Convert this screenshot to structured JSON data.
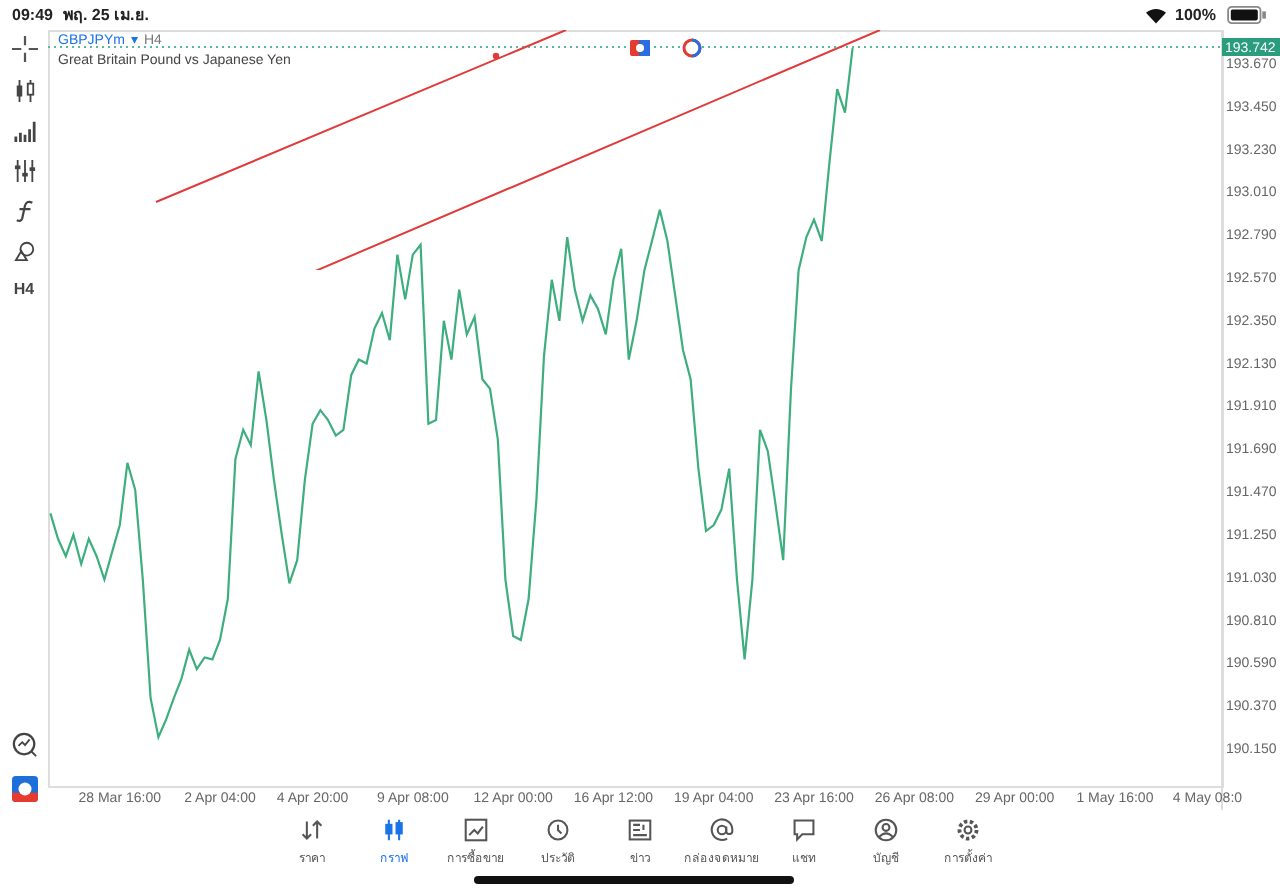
{
  "status_bar": {
    "time": "09:49",
    "date": "พฤ. 25 เม.ย.",
    "battery": "100%"
  },
  "toolbar": {
    "timeframe": "H4"
  },
  "chart_header": {
    "symbol": "GBPJPYm",
    "dropdown": "▾",
    "timeframe": "H4",
    "description": "Great Britain Pound vs Japanese Yen"
  },
  "current_price": "193.742",
  "chart_data": {
    "type": "line",
    "ylim": [
      189.826,
      193.834
    ],
    "categories": [
      null,
      null,
      null,
      null,
      null,
      null,
      null,
      null,
      null,
      "28 Mar 16:00",
      null,
      null,
      null,
      null,
      null,
      null,
      null,
      null,
      null,
      null,
      null,
      null,
      "2 Apr 04:00",
      null,
      null,
      null,
      null,
      null,
      null,
      null,
      null,
      null,
      null,
      null,
      "4 Apr 20:00",
      null,
      null,
      null,
      null,
      null,
      null,
      null,
      null,
      null,
      null,
      null,
      null,
      "9 Apr 08:00",
      null,
      null,
      null,
      null,
      null,
      null,
      null,
      null,
      null,
      null,
      null,
      null,
      "12 Apr 00:00",
      null,
      null,
      null,
      null,
      null,
      null,
      null,
      null,
      null,
      null,
      null,
      null,
      "16 Apr 12:00",
      null,
      null,
      null,
      null,
      null,
      null,
      null,
      null,
      null,
      null,
      null,
      null,
      "19 Apr 04:00",
      null,
      null,
      null,
      null,
      null,
      null,
      null,
      null,
      null,
      null,
      null,
      null,
      "23 Apr 16:00",
      null,
      null,
      null,
      null,
      null,
      null,
      null,
      null,
      null,
      null,
      null,
      null,
      "26 Apr 08:00",
      null,
      null,
      null,
      null,
      null,
      null,
      null,
      null,
      null,
      null,
      null,
      null,
      "29 Apr 00:00",
      null,
      null,
      null,
      null,
      null,
      null,
      null,
      null,
      null,
      null,
      null,
      null,
      "1 May 16:00",
      null,
      null,
      null,
      null,
      null,
      null,
      null,
      null,
      null,
      null,
      null,
      "4 May 08:0",
      null,
      null,
      null,
      null,
      null,
      null,
      null,
      null,
      null
    ],
    "yticks": [
      {
        "value": 193.67,
        "label": "193.670"
      },
      {
        "value": 193.45,
        "label": "193.450"
      },
      {
        "value": 193.23,
        "label": "193.230"
      },
      {
        "value": 193.01,
        "label": "193.010"
      },
      {
        "value": 192.79,
        "label": "192.790"
      },
      {
        "value": 192.57,
        "label": "192.570"
      },
      {
        "value": 192.35,
        "label": "192.350"
      },
      {
        "value": 192.13,
        "label": "192.130"
      },
      {
        "value": 191.91,
        "label": "191.910"
      },
      {
        "value": 191.69,
        "label": "191.690"
      },
      {
        "value": 191.47,
        "label": "191.470"
      },
      {
        "value": 191.25,
        "label": "191.250"
      },
      {
        "value": 191.03,
        "label": "191.030"
      },
      {
        "value": 190.81,
        "label": "190.810"
      },
      {
        "value": 190.59,
        "label": "190.590"
      },
      {
        "value": 190.37,
        "label": "190.370"
      },
      {
        "value": 190.15,
        "label": "190.150"
      }
    ],
    "series": [
      {
        "color": "#3fae7f",
        "values": [
          191.35,
          191.22,
          191.13,
          191.24,
          191.09,
          191.22,
          191.13,
          191.01,
          191.15,
          191.29,
          191.61,
          191.47,
          191.01,
          190.4,
          190.2,
          190.29,
          190.4,
          190.5,
          190.65,
          190.55,
          190.61,
          190.6,
          190.7,
          190.91,
          191.63,
          191.78,
          191.7,
          192.08,
          191.83,
          191.52,
          191.24,
          190.99,
          191.11,
          191.52,
          191.81,
          191.88,
          191.83,
          191.75,
          191.78,
          192.06,
          192.14,
          192.12,
          192.3,
          192.38,
          192.24,
          192.68,
          192.45,
          192.68,
          192.73,
          191.81,
          191.83,
          192.34,
          192.14,
          192.5,
          192.27,
          192.36,
          192.04,
          191.99,
          191.73,
          191.01,
          190.72,
          190.7,
          190.91,
          191.42,
          192.16,
          192.55,
          192.34,
          192.77,
          192.5,
          192.34,
          192.47,
          192.4,
          192.27,
          192.55,
          192.71,
          192.14,
          192.34,
          192.6,
          192.75,
          192.91,
          192.75,
          192.47,
          192.19,
          192.04,
          191.58,
          191.26,
          191.29,
          191.37,
          191.58,
          191.01,
          190.6,
          191.01,
          191.78,
          191.67,
          191.4,
          191.11,
          191.99,
          192.6,
          192.77,
          192.86,
          192.75,
          193.15,
          193.53,
          193.41,
          193.74,
          null,
          null,
          null,
          null,
          null,
          null,
          null,
          null,
          null,
          null,
          null,
          null,
          null,
          null,
          null,
          null,
          null,
          null,
          null,
          null,
          null,
          null,
          null,
          null,
          null,
          null,
          null,
          null,
          null,
          null,
          null,
          null,
          null,
          null,
          null,
          null,
          null,
          null,
          null,
          null,
          null,
          null,
          null,
          null,
          null,
          null,
          null,
          null,
          null,
          null,
          null,
          null,
          null,
          null,
          null
        ]
      }
    ]
  },
  "tabs": [
    {
      "label": "ราคา",
      "selected": false
    },
    {
      "label": "กราฟ",
      "selected": true
    },
    {
      "label": "การซื้อขาย",
      "selected": false
    },
    {
      "label": "ประวัติ",
      "selected": false
    },
    {
      "label": "ข่าว",
      "selected": false
    },
    {
      "label": "กล่องจดหมาย",
      "selected": false
    },
    {
      "label": "แชท",
      "selected": false
    },
    {
      "label": "บัญชี",
      "selected": false
    },
    {
      "label": "การตั้งค่า",
      "selected": false
    }
  ]
}
